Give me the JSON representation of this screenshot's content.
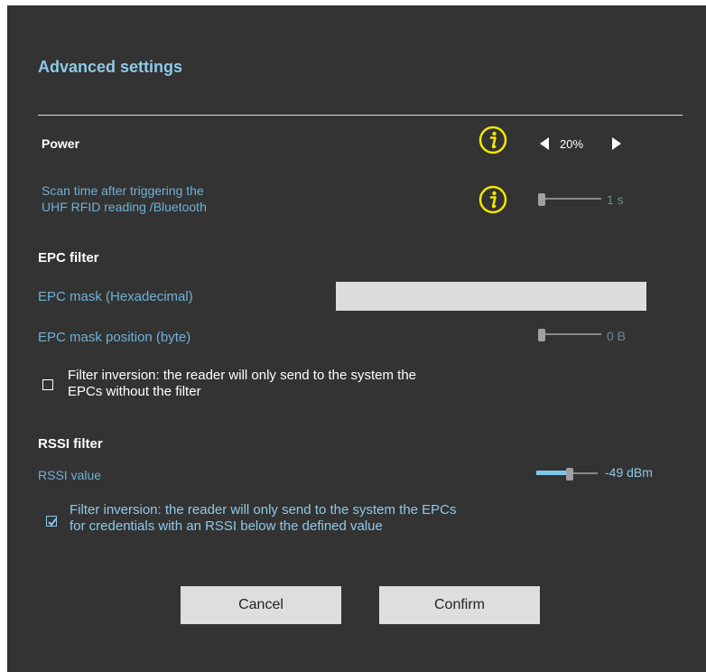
{
  "dialog": {
    "title": "Advanced settings"
  },
  "power": {
    "label": "Power",
    "value": "20%",
    "info_icon": "info-icon"
  },
  "scan_time": {
    "label_line1": "Scan time after triggering the",
    "label_line2": "UHF RFID reading /Bluetooth",
    "value": "1 s",
    "level": 0
  },
  "epc_filter": {
    "heading": "EPC filter",
    "mask_label": "EPC mask (Hexadecimal)",
    "mask_value": "",
    "position_label": "EPC mask position (byte)",
    "position_value": "0 B",
    "position_level": 0,
    "inversion_line1": "Filter inversion: the reader will only send to the system the",
    "inversion_line2": "EPCs without the filter",
    "inversion_checked": false
  },
  "rssi_filter": {
    "heading": "RSSI filter",
    "value_label": "RSSI value",
    "value": "-49 dBm",
    "level_percent": 55,
    "inversion_line1": "Filter inversion: the reader will only send to the system the EPCs",
    "inversion_line2": "for credentials with an RSSI below the defined value",
    "inversion_checked": true
  },
  "buttons": {
    "cancel": "Cancel",
    "confirm": "Confirm"
  },
  "colors": {
    "background": "#333333",
    "accent": "#8ec9e8",
    "info_icon": "#f2e600"
  }
}
